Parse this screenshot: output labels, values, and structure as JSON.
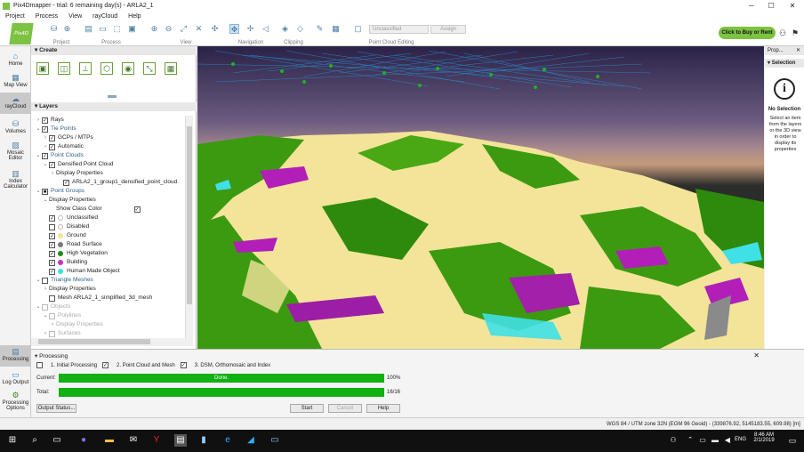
{
  "window": {
    "title": "Pix4Dmapper - trial: 6 remaining day(s) - ARLA2_1"
  },
  "menu": [
    "Project",
    "Process",
    "View",
    "rayCloud",
    "Help"
  ],
  "ribbon": {
    "groups": [
      "Project",
      "Process",
      "View",
      "Navigation",
      "Clipping",
      "Point Cloud Editing"
    ],
    "class_combo": "Unclassified",
    "assign_label": "Assign",
    "logo_text": "Pix4D",
    "buy_label": "Click to Buy or Rent"
  },
  "nav": [
    "Home",
    "Map View",
    "rayCloud",
    "Volumes",
    "Mosaic Editor",
    "Index Calculator",
    "Processing",
    "Log Output",
    "Processing Options"
  ],
  "create": {
    "title": "Create"
  },
  "layers": {
    "title": "Layers",
    "rows": [
      {
        "label": "Rays",
        "lvl": 0,
        "arrow": "›",
        "check": "✓",
        "dis": false,
        "style": ""
      },
      {
        "label": "Tie Points",
        "lvl": 0,
        "arrow": "⌄",
        "check": "✓",
        "dis": false,
        "style": "blue"
      },
      {
        "label": "GCPs / MTPs",
        "lvl": 1,
        "arrow": "›",
        "check": "✓",
        "dis": false,
        "style": ""
      },
      {
        "label": "Automatic",
        "lvl": 1,
        "arrow": "›",
        "check": "✓",
        "dis": false,
        "style": ""
      },
      {
        "label": "Point Clouds",
        "lvl": 0,
        "arrow": "⌄",
        "check": "✓",
        "dis": false,
        "style": "blue"
      },
      {
        "label": "Densified Point Cloud",
        "lvl": 1,
        "arrow": "⌄",
        "check": "✓",
        "dis": false,
        "style": ""
      },
      {
        "label": "Display Properties",
        "lvl": 2,
        "arrow": "›",
        "check": null,
        "dis": false,
        "style": ""
      },
      {
        "label": "ARLA2_1_group1_densified_point_cloud",
        "lvl": 3,
        "arrow": "",
        "check": "✓",
        "dis": false,
        "style": ""
      },
      {
        "label": "Point Groups",
        "lvl": 0,
        "arrow": "⌄",
        "check": "■",
        "dis": false,
        "style": "blue"
      },
      {
        "label": "Display Properties",
        "lvl": 1,
        "arrow": "⌄",
        "check": null,
        "dis": false,
        "style": ""
      },
      {
        "label": "Show Class Color",
        "lvl": 2,
        "arrow": "",
        "check": null,
        "dis": false,
        "style": ""
      },
      {
        "label": "Unclassified",
        "lvl": 1,
        "arrow": "",
        "check": "✓",
        "dis": false,
        "style": "",
        "color": "#ffffff"
      },
      {
        "label": "Disabled",
        "lvl": 1,
        "arrow": "",
        "check": "",
        "dis": false,
        "style": "",
        "color": "#ffffff"
      },
      {
        "label": "Ground",
        "lvl": 1,
        "arrow": "",
        "check": "✓",
        "dis": false,
        "style": "",
        "color": "#f3e49a"
      },
      {
        "label": "Road Surface",
        "lvl": 1,
        "arrow": "",
        "check": "✓",
        "dis": false,
        "style": "",
        "color": "#7a7a7a"
      },
      {
        "label": "High Vegetation",
        "lvl": 1,
        "arrow": "",
        "check": "✓",
        "dis": false,
        "style": "",
        "color": "#1e8a1e"
      },
      {
        "label": "Building",
        "lvl": 1,
        "arrow": "",
        "check": "✓",
        "dis": false,
        "style": "",
        "color": "#c82fc8"
      },
      {
        "label": "Human Made Object",
        "lvl": 1,
        "arrow": "",
        "check": "✓",
        "dis": false,
        "style": "",
        "color": "#3fe0e6"
      },
      {
        "label": "Triangle Meshes",
        "lvl": 0,
        "arrow": "⌄",
        "check": "",
        "dis": false,
        "style": "blue"
      },
      {
        "label": "Display Properties",
        "lvl": 1,
        "arrow": "›",
        "check": null,
        "dis": false,
        "style": ""
      },
      {
        "label": "Mesh ARLA2_1_simplified_3d_mesh",
        "lvl": 1,
        "arrow": "",
        "check": "",
        "dis": false,
        "style": ""
      },
      {
        "label": "Objects",
        "lvl": 0,
        "arrow": "⌄",
        "check": "",
        "dis": true,
        "style": "gray"
      },
      {
        "label": "Polylines",
        "lvl": 1,
        "arrow": "⌄",
        "check": "",
        "dis": true,
        "style": "gray"
      },
      {
        "label": "Display Properties",
        "lvl": 2,
        "arrow": "›",
        "check": null,
        "dis": false,
        "style": "gray"
      },
      {
        "label": "Surfaces",
        "lvl": 1,
        "arrow": "›",
        "check": "",
        "dis": true,
        "style": "gray"
      }
    ]
  },
  "properties": {
    "tab": "Prop...",
    "title": "Selection",
    "heading": "No Selection",
    "desc": "Select an item from the layers or the 3D view in order to display its properties"
  },
  "processing": {
    "title": "Processing",
    "steps": [
      {
        "label": "1. Initial Processing",
        "checked": false
      },
      {
        "label": "2. Point Cloud and Mesh",
        "checked": true
      },
      {
        "label": "3. DSM, Orthomosaic and Index",
        "checked": true
      }
    ],
    "current_label": "Current:",
    "current_text": "Done.",
    "current_pct": "100%",
    "current_fill": 1.0,
    "total_label": "Total:",
    "total_count": "16/16",
    "total_fill": 1.0,
    "output_status": "Output Status...",
    "start": "Start",
    "cancel": "Cancel",
    "help": "Help"
  },
  "status": {
    "coords": "WGS 84 / UTM zone 32N (EGM 96 Geoid) - (339876.92, 5145183.55, 609.98) [m]"
  },
  "taskbar": {
    "lang": "ENG",
    "time": "8:46 AM",
    "date": "2/1/2019"
  }
}
